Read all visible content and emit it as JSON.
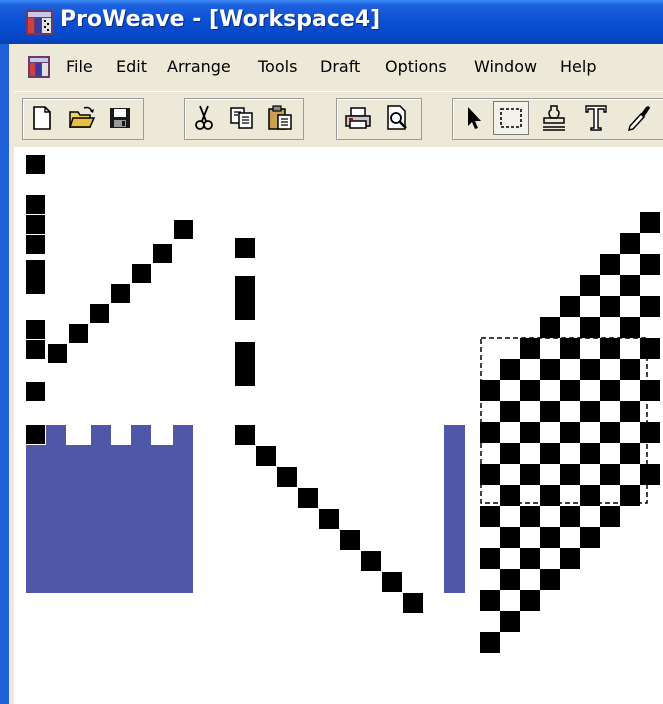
{
  "window": {
    "title": "ProWeave - [Workspace4]",
    "app_icon": "proweave-app-icon"
  },
  "menu": {
    "doc_icon": "document-window-icon",
    "items": [
      "File",
      "Edit",
      "Arrange",
      "Tools",
      "Draft",
      "Options",
      "Window",
      "Help"
    ]
  },
  "toolbar": {
    "buttons": [
      {
        "name": "new-icon"
      },
      {
        "name": "open-folder-icon"
      },
      {
        "name": "save-icon"
      },
      {
        "name": "cut-icon"
      },
      {
        "name": "copy-icon"
      },
      {
        "name": "paste-icon"
      },
      {
        "name": "print-icon"
      },
      {
        "name": "print-preview-icon"
      },
      {
        "name": "pointer-tool-icon"
      },
      {
        "name": "rectangle-select-tool-icon"
      },
      {
        "name": "stamp-tool-icon"
      },
      {
        "name": "text-tool-icon"
      },
      {
        "name": "eyedropper-tool-icon"
      }
    ]
  },
  "colors": {
    "title_bar": "#0a4fd4",
    "chrome": "#ece9d8",
    "fill_block": "#4f57a8",
    "accent_cell": "#7a2a6a",
    "cell": "#000000"
  }
}
